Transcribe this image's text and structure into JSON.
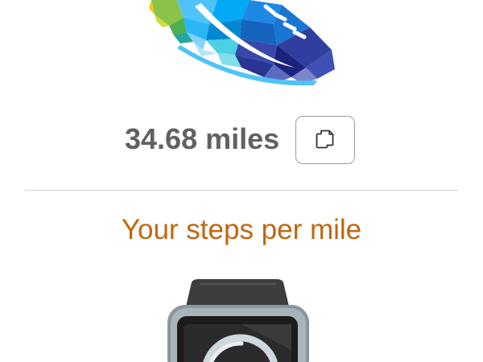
{
  "distance": {
    "value_text": "34.68 miles"
  },
  "copy_button": {
    "icon": "copy-icon"
  },
  "steps_section": {
    "title": "Your steps per mile"
  },
  "graphics": {
    "shoe": "running-shoe-illustration",
    "watch": "smartwatch-illustration"
  },
  "colors": {
    "distance_text": "#616161",
    "section_title": "#c2660f",
    "button_border": "#9c9c9c",
    "divider": "#cfcfcf"
  }
}
